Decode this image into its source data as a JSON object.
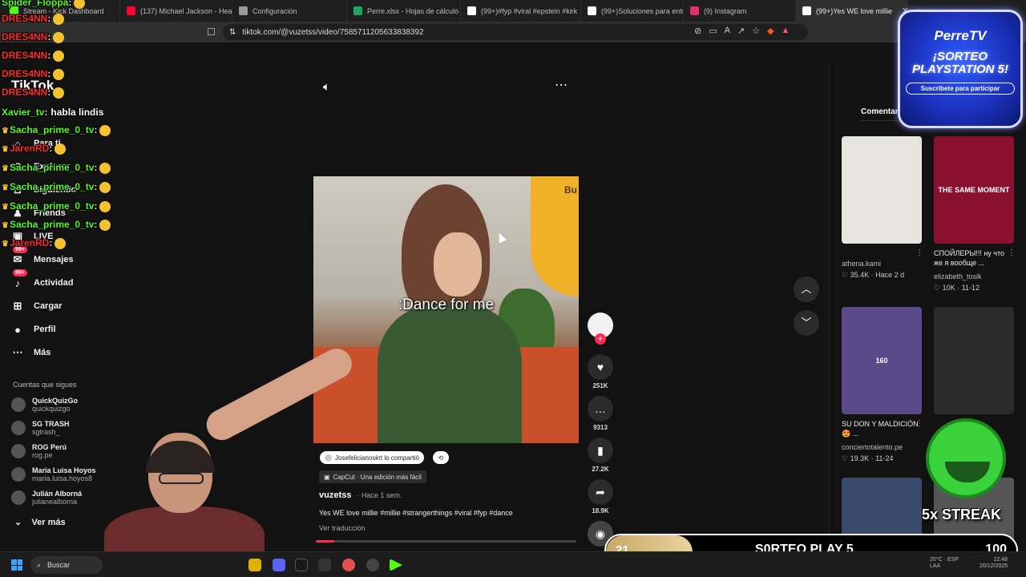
{
  "browser": {
    "tabs": [
      {
        "label": "Stream - Kick Dashboard",
        "color": "#53fc18"
      },
      {
        "label": "(137) Michael Jackson - Heartb",
        "color": "#ff0033"
      },
      {
        "label": "Configuración",
        "color": "#9a9a9a"
      },
      {
        "label": "Perre.xlsx - Hojas de cálculo de",
        "color": "#1fa463"
      },
      {
        "label": "(99+)#fyp #viral #epstein #kirk",
        "color": "#ffffff"
      },
      {
        "label": "(99+)Soluciones para entradas",
        "color": "#ffffff"
      },
      {
        "label": "(9) Instagram",
        "color": "#e1306c"
      },
      {
        "label": "(99+)Yes WE love millie",
        "color": "#ffffff"
      }
    ],
    "url": "tiktok.com/@vuzetss/video/7585711205633838392"
  },
  "sidebar": {
    "logo": "TikTok",
    "nav": [
      {
        "label": "Para ti",
        "icon": "home-icon",
        "glyph": "⌂"
      },
      {
        "label": "Explorar",
        "icon": "compass-icon",
        "glyph": "◎"
      },
      {
        "label": "Siguiendo",
        "icon": "following-icon",
        "glyph": "♙"
      },
      {
        "label": "Friends",
        "icon": "friends-icon",
        "glyph": "♟"
      },
      {
        "label": "LIVE",
        "icon": "live-icon",
        "glyph": "▣"
      },
      {
        "label": "Mensajes",
        "icon": "message-icon",
        "glyph": "✉",
        "badge": "99+"
      },
      {
        "label": "Actividad",
        "icon": "bell-icon",
        "glyph": "♪",
        "badge": "99+"
      },
      {
        "label": "Cargar",
        "icon": "upload-icon",
        "glyph": "⊞"
      },
      {
        "label": "Perfil",
        "icon": "profile-icon",
        "glyph": "●"
      },
      {
        "label": "Más",
        "icon": "more-icon",
        "glyph": "⋯"
      }
    ],
    "following_title": "Cuentas que sigues",
    "following": [
      {
        "name": "QuickQuizGo",
        "handle": "quickquizgo"
      },
      {
        "name": "SG TRASH",
        "handle": "sgtrash_"
      },
      {
        "name": "ROG Perú",
        "handle": "rog.pe"
      },
      {
        "name": "Maria Luisa Hoyos",
        "handle": "maria.luisa.hoyos8"
      },
      {
        "name": "Julián Alborná",
        "handle": "julianealborna"
      }
    ],
    "see_more": "Ver más"
  },
  "chat": [
    {
      "user": "Spider_Floppa",
      "text": "",
      "color": "#53fc18",
      "crown": false
    },
    {
      "user": "DRES4NN",
      "text": "",
      "color": "#ff2a2a",
      "crown": false
    },
    {
      "user": "DRES4NN",
      "text": "",
      "color": "#ff2a2a",
      "crown": false
    },
    {
      "user": "DRES4NN",
      "text": "",
      "color": "#ff2a2a",
      "crown": false
    },
    {
      "user": "DRES4NN",
      "text": "",
      "color": "#ff2a2a",
      "crown": false
    },
    {
      "user": "DRES4NN",
      "text": "",
      "color": "#ff2a2a",
      "crown": false
    },
    {
      "user": "Xavier_tv",
      "text": "habla lindis",
      "color": "#53fc18",
      "crown": false
    },
    {
      "user": "Sacha_prime_0_tv",
      "text": "",
      "color": "#53fc18",
      "crown": true
    },
    {
      "user": "JarenRD",
      "text": "",
      "color": "#ff2a2a",
      "crown": true
    },
    {
      "user": "Sacha_prime_0_tv",
      "text": "",
      "color": "#53fc18",
      "crown": true
    },
    {
      "user": "Sacha_prime_0_tv",
      "text": "",
      "color": "#53fc18",
      "crown": true
    },
    {
      "user": "Sacha_prime_0_tv",
      "text": "",
      "color": "#53fc18",
      "crown": true
    },
    {
      "user": "Sacha_prime_0_tv",
      "text": "",
      "color": "#53fc18",
      "crown": true
    },
    {
      "user": "JarenRD",
      "text": "",
      "color": "#ff2a2a",
      "crown": true
    }
  ],
  "video": {
    "caption": ":Dance for me",
    "brand": "Bu",
    "shared_by": "Josefelicianoskrt lo compartió",
    "capcut": "CapCut · Una edición más fácil",
    "author": "vuzetss",
    "posted": "· Hace 1 sem.",
    "description": "Yes WE love millie #millie #strangerthings #viral #fyp #dance",
    "translate": "Ver traducción",
    "progress": 0.07
  },
  "actions": {
    "likes": "251K",
    "comments": "9313",
    "saves": "27.2K",
    "shares": "18.9K"
  },
  "right_panel": {
    "tab": "Comentarios",
    "videos": [
      {
        "caption": "",
        "user": "athena.kami",
        "likes": "35.4K",
        "date": "Hace 2 d",
        "bg": "#e8e4de",
        "overlay": ""
      },
      {
        "caption": "СПОЙЛЕРЫ!!! ну что же я вообще ...",
        "user": "elizabeth_tosik",
        "likes": "10K",
        "date": "11-12",
        "bg": "#8a1030",
        "overlay": "THE SAME MOMENT"
      },
      {
        "caption": "SU DON Y MALDICIÓN 😍 ...",
        "user": "conciertotalento.pe",
        "likes": "19.3K",
        "date": "11-24",
        "bg": "#5a4a8a",
        "overlay": "160"
      },
      {
        "caption": "",
        "user": "",
        "likes": "",
        "date": "",
        "bg": "#2a2a2a",
        "overlay": ""
      },
      {
        "caption": "",
        "user": "",
        "likes": "",
        "date": "",
        "bg": "#3a4a6a",
        "overlay": ""
      },
      {
        "caption": "",
        "user": "",
        "likes": "",
        "date": "",
        "bg": "#555555",
        "overlay": ""
      }
    ]
  },
  "promo": {
    "title": "PerreTV",
    "line1": "¡SORTEO",
    "line2": "PLAYSTATION 5!",
    "cta": "Suscríbete para participar"
  },
  "streak": "5x STREAK",
  "goal": {
    "current": "21",
    "label": "S0RTEO PLAY 5",
    "target": "100",
    "fraction": 0.21
  },
  "taskbar": {
    "search": "Buscar",
    "weather": "20°C",
    "lang": "ESP",
    "lang2": "LAA",
    "time": "22:48",
    "date": "20/12/2025"
  }
}
